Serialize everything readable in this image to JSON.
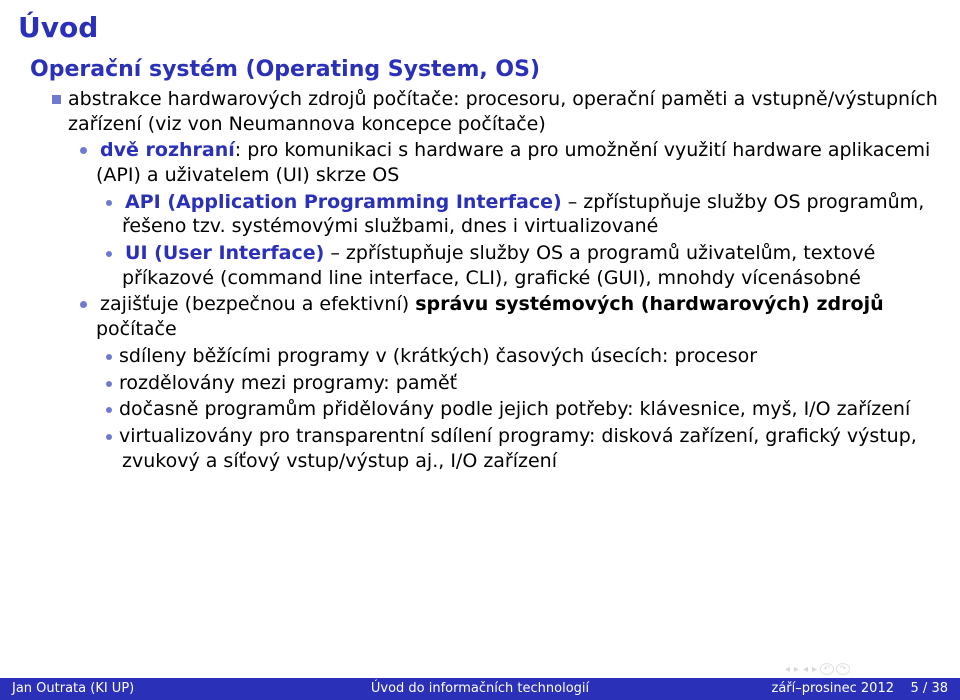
{
  "title": "Úvod",
  "heading": "Operační systém (Operating System, OS)",
  "b1_1a": "abstrakce hardwarových zdrojů počítače: procesoru, operační paměti a vstupně/výstupních zařízení (viz von Neumannova koncepce počítače)",
  "b2_1_label": "dvě rozhraní",
  "b2_1_rest": ": pro komunikaci s hardware a pro umožnění využití hardware aplikacemi (API) a uživatelem (UI) skrze OS",
  "b3_1_label": "API (Application Programming Interface)",
  "b3_1_rest": " – zpřístupňuje služby OS programům, řešeno tzv. systémovými službami, dnes i virtualizované",
  "b3_2_label": "UI (User Interface)",
  "b3_2_rest": " – zpřístupňuje služby OS a programů uživatelům, textové příkazové (command line interface, CLI), grafické (GUI), mnohdy vícenásobné",
  "b2_2_pre": "zajišťuje (bezpečnou a efektivní) ",
  "b2_2_bold": "správu systémových (hardwarových) zdrojů",
  "b2_2_post": " počítače",
  "b3_3": "sdíleny běžícími programy v (krátkých) časových úsecích: procesor",
  "b3_4": "rozdělovány mezi programy: paměť",
  "b3_5": "dočasně programům přidělovány podle jejich potřeby: klávesnice, myš, I/O zařízení",
  "b3_6": "virtualizovány pro transparentní sdílení programy: disková zařízení, grafický výstup, zvukový a síťový vstup/výstup aj., I/O zařízení",
  "footer": {
    "left": "Jan Outrata (KI UP)",
    "center": "Úvod do informačních technologií",
    "date": "září–prosinec 2012",
    "page": "5 / 38"
  },
  "nav": {
    "a": "◂",
    "b": "▸",
    "c": "◂",
    "d": "▸",
    "e": "↶",
    "f": "↷"
  }
}
